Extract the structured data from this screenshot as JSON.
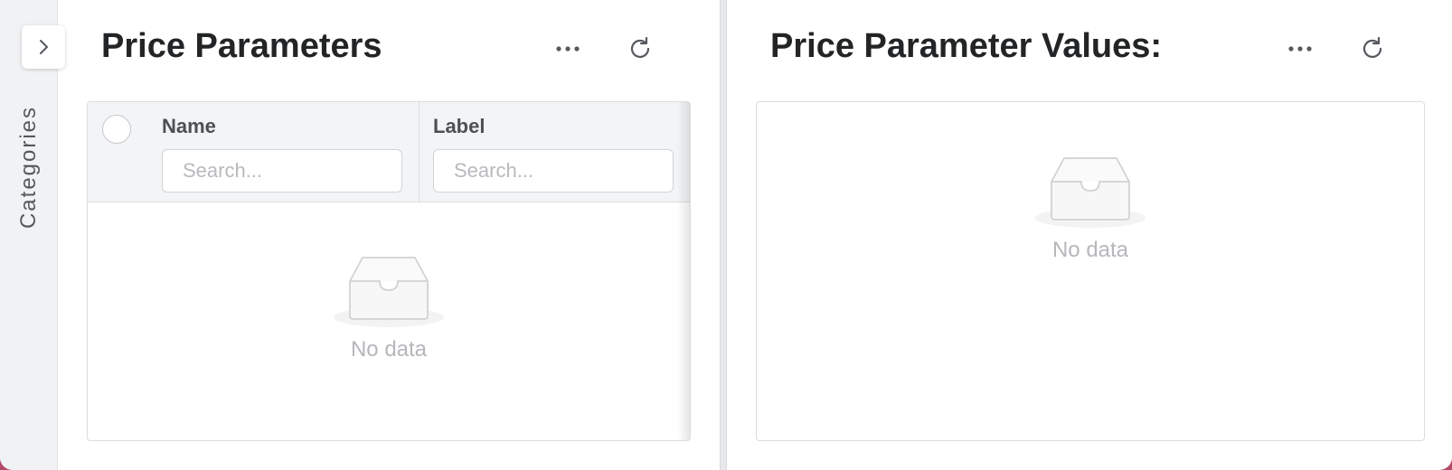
{
  "sidebar": {
    "label": "Categories",
    "toggle_icon": "chevron-right-icon"
  },
  "left_panel": {
    "title": "Price Parameters",
    "more_icon": "ellipsis-icon",
    "refresh_icon": "refresh-icon",
    "columns": [
      {
        "label": "Name",
        "search_placeholder": "Search..."
      },
      {
        "label": "Label",
        "search_placeholder": "Search..."
      }
    ],
    "empty_text": "No data",
    "empty_icon": "empty-inbox-icon"
  },
  "right_panel": {
    "title": "Price Parameter Values:",
    "more_icon": "ellipsis-icon",
    "refresh_icon": "refresh-icon",
    "empty_text": "No data",
    "empty_icon": "empty-inbox-icon"
  },
  "colors": {
    "background_accent": "#b24a6a",
    "title": "#222426",
    "muted": "#b5b7bb"
  }
}
